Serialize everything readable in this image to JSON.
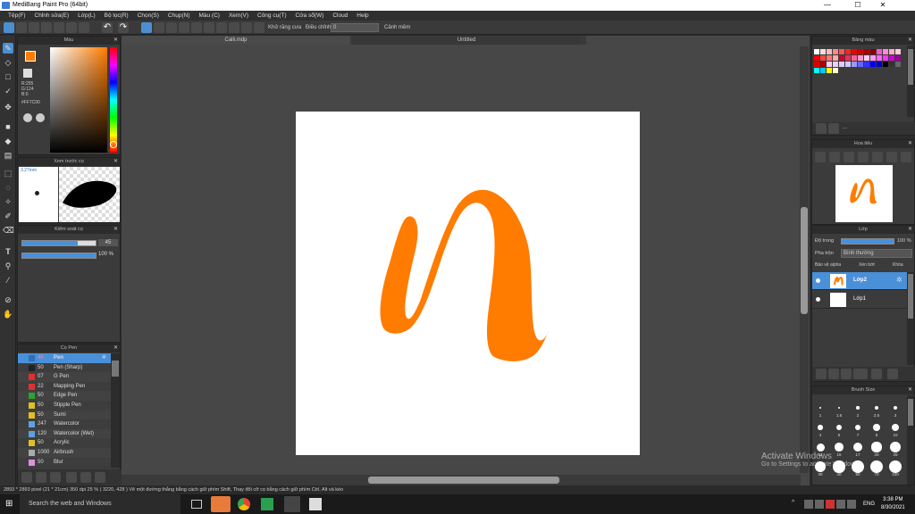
{
  "window": {
    "title": "MediBang Paint Pro (64bit)",
    "min": "—",
    "max": "☐",
    "close": "✕"
  },
  "menu": [
    "Tệp(F)",
    "Chỉnh sửa(E)",
    "Lớp(L)",
    "Bộ lọc(R)",
    "Chọn(S)",
    "Chụp(N)",
    "Màu (C)",
    "Xem(V)",
    "Công cụ(T)",
    "Cửa sổ(W)",
    "Cloud",
    "Help"
  ],
  "toolbar": {
    "antialias_label": "Khử răng cưa",
    "correction_label": "Điều chỉnh",
    "correction_value": "0",
    "warn_label": "Cảnh mềm"
  },
  "tabs": {
    "file1": "Calli.mdp",
    "file2": "Untitled"
  },
  "color_panel": {
    "title": "Màu",
    "r": "R:255",
    "g": "G:124",
    "b": "B:0",
    "hex": "#FF7C00",
    "fg_color": "#ff7c00",
    "bg_color": "#ffffff"
  },
  "brush_preview": {
    "title": "Xem trước cọ",
    "size": "3.27mm"
  },
  "brush_control": {
    "title": "Kiểm soát cọ",
    "size_value": "45",
    "opacity_value": "100 %",
    "size_fraction": 0.75,
    "opacity_fraction": 1.0
  },
  "brush_list": {
    "title": "Cọ Pen",
    "items": [
      {
        "size": "45",
        "name": "Pen",
        "color": "#2d6fb8",
        "selected": true
      },
      {
        "size": "50",
        "name": "Pen (Sharp)",
        "color": "#222222",
        "selected": false
      },
      {
        "size": "07",
        "name": "G Pen",
        "color": "#e03030",
        "selected": false
      },
      {
        "size": "22",
        "name": "Mapping Pen",
        "color": "#e03030",
        "selected": false
      },
      {
        "size": "50",
        "name": "Edge Pen",
        "color": "#30a030",
        "selected": false
      },
      {
        "size": "50",
        "name": "Stipple Pen",
        "color": "#e0c020",
        "selected": false
      },
      {
        "size": "50",
        "name": "Sumi",
        "color": "#e0c020",
        "selected": false
      },
      {
        "size": "247",
        "name": "Watercolor",
        "color": "#60a0e0",
        "selected": false
      },
      {
        "size": "120",
        "name": "Watercolor (Wet)",
        "color": "#60a0e0",
        "selected": false
      },
      {
        "size": "50",
        "name": "Acrylic",
        "color": "#e0c020",
        "selected": false
      },
      {
        "size": "1000",
        "name": "Airbrush",
        "color": "#aaaaaa",
        "selected": false
      },
      {
        "size": "50",
        "name": "Blur",
        "color": "#e090e0",
        "selected": false
      }
    ]
  },
  "palette_panel": {
    "title": "Bảng màu",
    "extra": "..."
  },
  "navigator": {
    "title": "Hoa tiêu"
  },
  "layer_panel": {
    "title": "Lớp",
    "opacity_label": "Độ trong",
    "opacity_value": "100 %",
    "opacity_fraction": 1.0,
    "blend_label": "Pha trộn",
    "blend_value": "Bình thường",
    "protect_alpha": "Bảo vệ alpha",
    "clipping": "Xén bớt",
    "lock": "Khóa",
    "layers": [
      {
        "name": "Lớp2",
        "selected": true
      },
      {
        "name": "Lớp1",
        "selected": false
      }
    ]
  },
  "brush_size": {
    "title": "Brush Size",
    "labels": [
      "1",
      "1.5",
      "2",
      "2.5",
      "3",
      "4",
      "5",
      "7",
      "8",
      "10",
      "12",
      "15",
      "17",
      "20",
      "25",
      "30",
      "40",
      "50",
      "70",
      "100"
    ]
  },
  "status": {
    "text": "2893 * 2893 pixel  (21 * 21cm)  350 dpi  25 %  ( 3220, 428 )  Vẽ một đường thẳng bằng cách giữ phím Shift, Thay đổi cỡ cọ bằng cách giữ phím Ctrl, Alt và kéo"
  },
  "watermark": {
    "line1": "Activate Windows",
    "line2": "Go to Settings to activate Windows."
  },
  "taskbar": {
    "search": "Search the web and Windows",
    "lang": "ENG",
    "time": "3:38 PM",
    "date": "8/30/2021"
  }
}
